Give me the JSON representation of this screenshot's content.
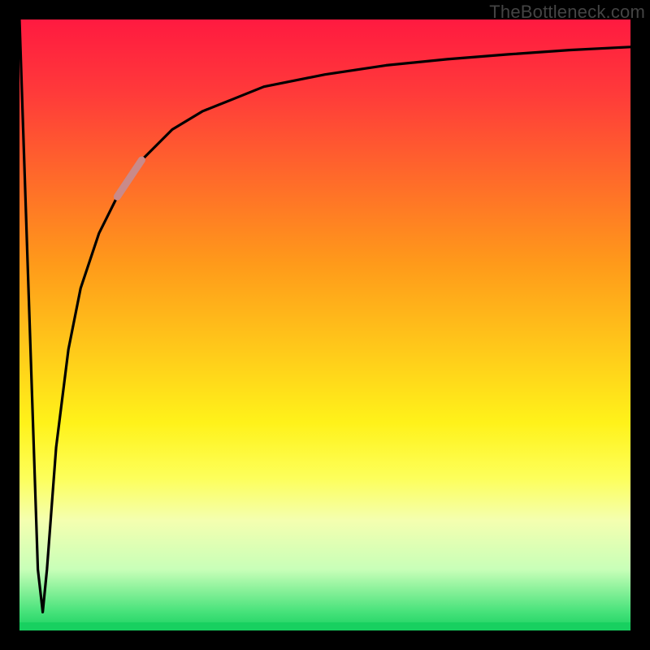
{
  "watermark": "TheBottleneck.com",
  "colors": {
    "frame": "#000000",
    "curve": "#000000",
    "highlight": "#c98a8a",
    "gradient_top": "#ff1a40",
    "gradient_bottom": "#18d060"
  },
  "chart_data": {
    "type": "line",
    "title": "",
    "xlabel": "",
    "ylabel": "",
    "xlim": [
      0,
      100
    ],
    "ylim": [
      0,
      100
    ],
    "grid": false,
    "legend": false,
    "series": [
      {
        "name": "bottleneck-curve",
        "x": [
          0,
          1.5,
          3.0,
          3.8,
          4.5,
          6,
          8,
          10,
          13,
          16,
          20,
          25,
          30,
          35,
          40,
          50,
          60,
          70,
          80,
          90,
          100
        ],
        "values": [
          100,
          55,
          10,
          3,
          10,
          30,
          46,
          56,
          65,
          71,
          77,
          82,
          85,
          87,
          89,
          91,
          92.5,
          93.5,
          94.3,
          95,
          95.5
        ]
      }
    ],
    "annotations": [
      {
        "name": "highlight-segment",
        "x_range": [
          14,
          20
        ],
        "note": "thicker lighter stroke on curve"
      }
    ]
  }
}
